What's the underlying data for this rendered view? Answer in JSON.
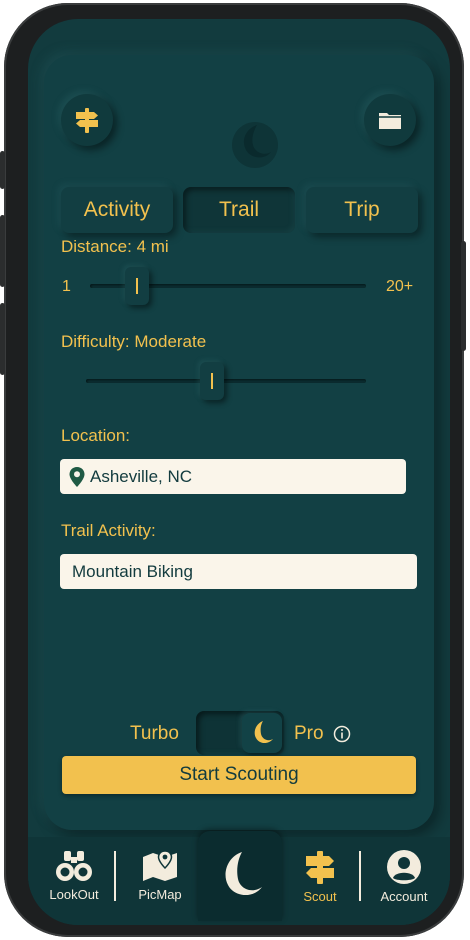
{
  "header": {
    "left_icon": "signpost-icon",
    "right_icon": "folder-icon",
    "logo_icon": "crescent-logo-icon"
  },
  "tabs": [
    {
      "label": "Activity",
      "active": false
    },
    {
      "label": "Trail",
      "active": true
    },
    {
      "label": "Trip",
      "active": false
    }
  ],
  "distance": {
    "label": "Distance: 4 mi",
    "min_label": "1",
    "max_label": "20+",
    "value_fraction": 0.17
  },
  "difficulty": {
    "label": "Difficulty: Moderate",
    "value_fraction": 0.45
  },
  "location": {
    "label": "Location:",
    "value": "Asheville, NC",
    "icon": "map-pin-icon"
  },
  "trail_activity": {
    "label": "Trail Activity:",
    "value": "Mountain Biking"
  },
  "mode": {
    "left_label": "Turbo",
    "right_label": "Pro",
    "info_icon": "info-icon",
    "selected": "Pro"
  },
  "start_button": {
    "label": "Start Scouting"
  },
  "bottom_nav": [
    {
      "label": "LookOut",
      "icon": "binoculars-icon",
      "active": false
    },
    {
      "label": "PicMap",
      "icon": "map-icon",
      "active": false
    },
    {
      "label": "",
      "icon": "crescent-logo-icon",
      "active": false
    },
    {
      "label": "Scout",
      "icon": "signpost-icon",
      "active": true
    },
    {
      "label": "Account",
      "icon": "user-icon",
      "active": false
    }
  ],
  "colors": {
    "background": "#123b3e",
    "accent": "#f2c14e",
    "field": "#faf5ea",
    "nav_text": "#f3ecdd"
  }
}
